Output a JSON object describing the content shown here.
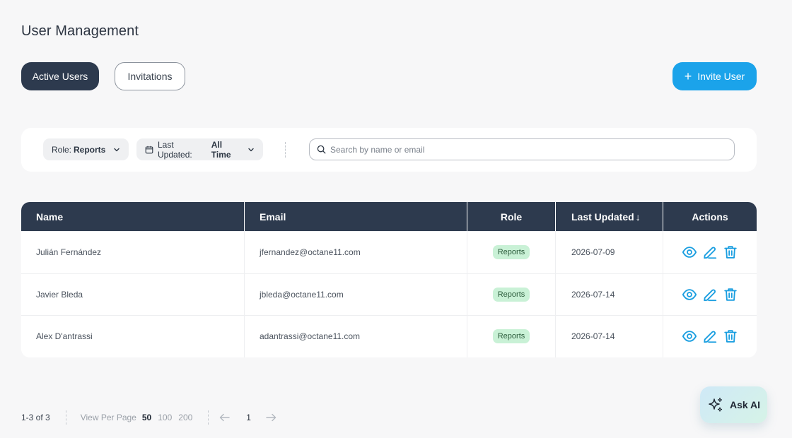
{
  "page": {
    "title": "User Management"
  },
  "tabs": [
    {
      "label": "Active Users",
      "active": true
    },
    {
      "label": "Invitations",
      "active": false
    }
  ],
  "invite_button": {
    "label": "Invite User",
    "icon": "plus-icon"
  },
  "filters": {
    "role": {
      "label": "Role:",
      "value": "Reports"
    },
    "last_updated": {
      "label": "Last Updated:",
      "value": "All Time"
    },
    "search": {
      "placeholder": "Search by name or email",
      "value": ""
    }
  },
  "table": {
    "columns": [
      "Name",
      "Email",
      "Role",
      "Last Updated",
      "Actions"
    ],
    "sort_indicator": "↓",
    "rows": [
      {
        "name": "Julián Fernández",
        "email": "jfernandez@octane11.com",
        "role": "Reports",
        "updated": "2026-07-09"
      },
      {
        "name": "Javier Bleda",
        "email": "jbleda@octane11.com",
        "role": "Reports",
        "updated": "2026-07-14"
      },
      {
        "name": "Alex D'antrassi",
        "email": "adantrassi@octane11.com",
        "role": "Reports",
        "updated": "2026-07-14"
      }
    ]
  },
  "pagination": {
    "range": "1-3 of 3",
    "view_per_page_label": "View Per Page",
    "options": [
      "50",
      "100",
      "200"
    ],
    "selected": "50",
    "current_page": "1"
  },
  "ask_ai": {
    "label": "Ask AI"
  },
  "colors": {
    "primary_dark": "#2d3a4e",
    "accent_blue": "#1ba3ea",
    "badge_green": "#c9f1d6",
    "action_icon": "#1a9ee0"
  }
}
